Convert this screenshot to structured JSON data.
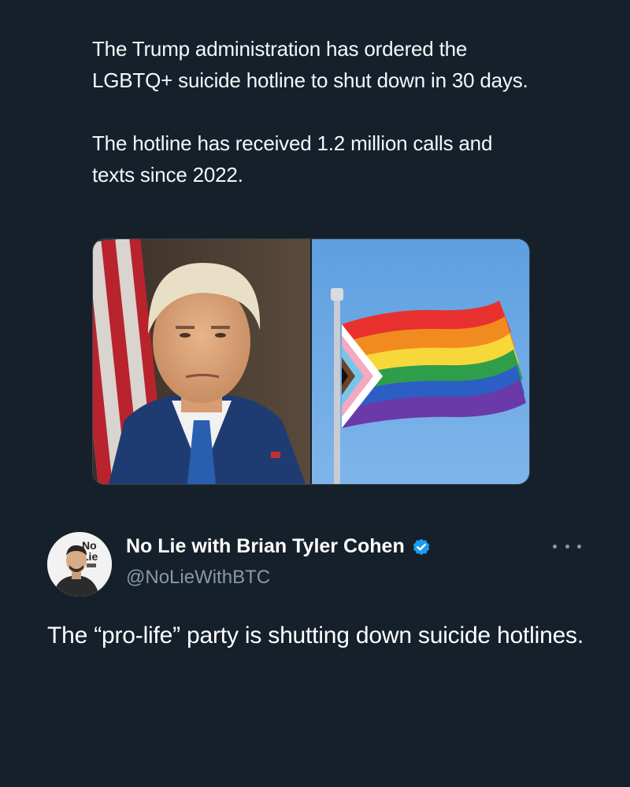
{
  "quoted_post": {
    "paragraphs": [
      "The Trump administration has ordered the LGBTQ+ suicide hotline to shut down in 30 days.",
      "The hotline has received 1.2 million calls and texts since 2022."
    ],
    "media": [
      {
        "icon": "portrait-photo"
      },
      {
        "icon": "progress-pride-flag-photo"
      }
    ]
  },
  "post": {
    "author_name": "No Lie with Brian Tyler Cohen",
    "handle": "@NoLieWithBTC",
    "verified_color": "#1d9bf0",
    "text": "The “pro-life” party is shutting down suicide hotlines.",
    "avatar_logo_lines": [
      "No",
      "Lie"
    ]
  },
  "theme": {
    "background": "#15202b",
    "text": "#ffffff",
    "muted": "#8899a6"
  }
}
